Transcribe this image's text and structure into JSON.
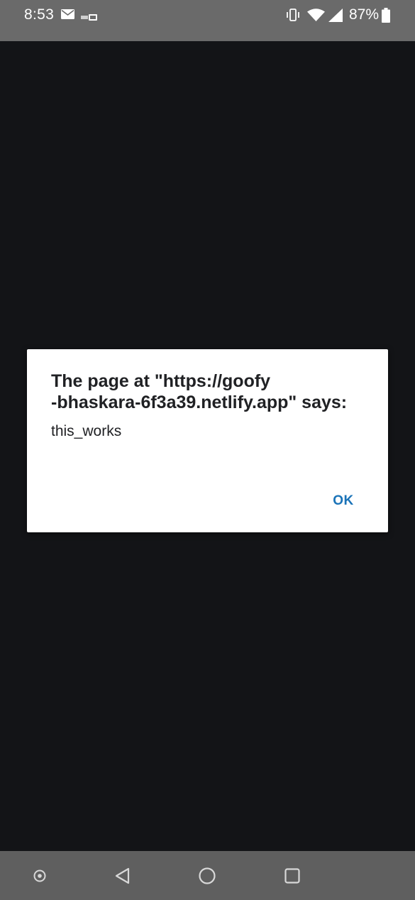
{
  "status_bar": {
    "time": "8:53",
    "battery_percent": "87%",
    "icons": [
      "mail-icon",
      "notification-badge-icon",
      "vibrate-icon",
      "wifi-icon",
      "signal-icon",
      "battery-icon"
    ]
  },
  "dialog": {
    "title_line1": "The page at \"https://goofy",
    "title_line2": "-bhaskara-6f3a39.netlify.app\" says:",
    "message": "this_works",
    "ok_label": "OK"
  },
  "nav_bar": {
    "icons": [
      "assistant-icon",
      "back-icon",
      "home-icon",
      "recents-icon"
    ]
  },
  "colors": {
    "background": "#131417",
    "status_bar": "#6a6a6a",
    "nav_bar": "#5f5f5f",
    "dialog_bg": "#ffffff",
    "ok_accent": "#1a73b8"
  }
}
